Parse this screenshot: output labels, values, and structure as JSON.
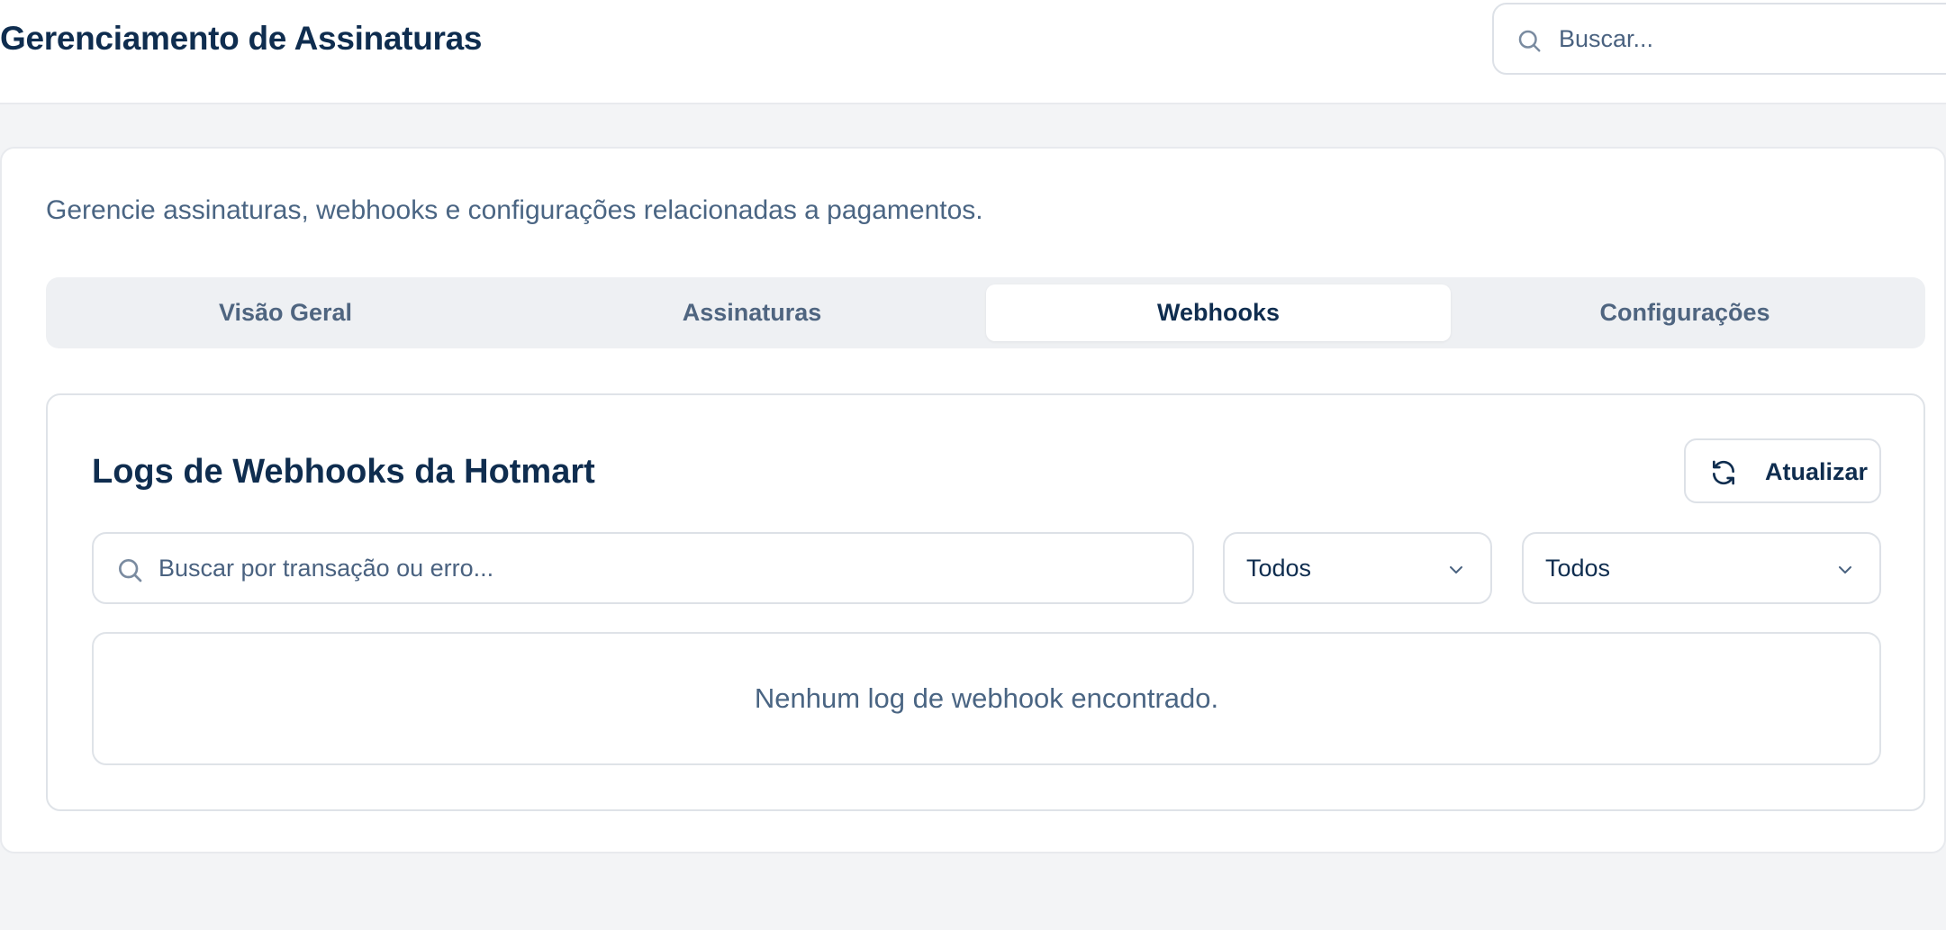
{
  "header": {
    "title": "Gerenciamento de Assinaturas",
    "search_placeholder": "Buscar..."
  },
  "main": {
    "subtitle": "Gerencie assinaturas, webhooks e configurações relacionadas a pagamentos.",
    "tabs": [
      {
        "label": "Visão Geral",
        "active": false
      },
      {
        "label": "Assinaturas",
        "active": false
      },
      {
        "label": "Webhooks",
        "active": true
      },
      {
        "label": "Configurações",
        "active": false
      }
    ]
  },
  "webhooks": {
    "title": "Logs de Webhooks da Hotmart",
    "refresh_label": "Atualizar",
    "search_placeholder": "Buscar por transação ou erro...",
    "filter_1_value": "Todos",
    "filter_2_value": "Todos",
    "empty_message": "Nenhum log de webhook encontrado."
  },
  "icons": {
    "search": "search-icon",
    "refresh": "refresh-icon",
    "chevron": "chevron-down-icon"
  },
  "colors": {
    "primary_text": "#0f2d4f",
    "muted_text": "#4a6583",
    "background": "#f3f4f6",
    "border": "#dde1e7"
  }
}
